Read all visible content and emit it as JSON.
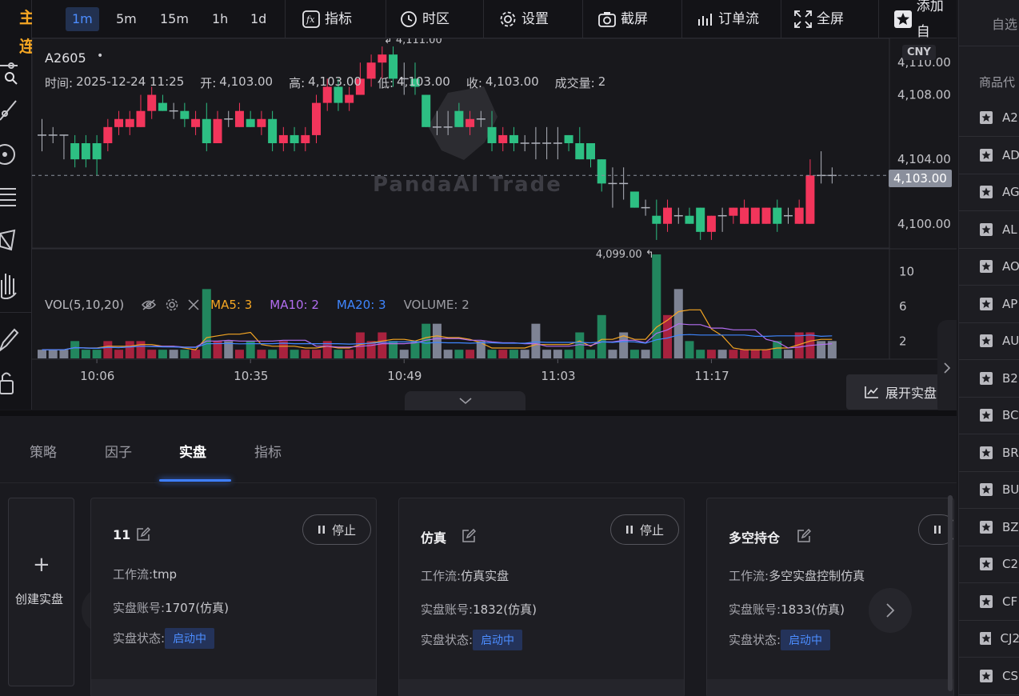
{
  "brand": {
    "line1": "主",
    "line2": "连"
  },
  "toolbar": {
    "timeframes": [
      "1m",
      "5m",
      "15m",
      "1h",
      "1d"
    ],
    "active_timeframe": "1m",
    "indicators_label": "指标",
    "timezone_label": "时区",
    "settings_label": "设置",
    "screenshot_label": "截屏",
    "orderflow_label": "订单流",
    "fullscreen_label": "全屏",
    "add_label": "添加自"
  },
  "chart": {
    "symbol": "A2605",
    "currency": "CNY",
    "time_label": "时间:",
    "time_value": "2025-12-24 11:25",
    "open_label": "开:",
    "open_value": "4,103.00",
    "high_label": "高:",
    "high_value": "4,103.00",
    "low_label": "低:",
    "low_value": "4,103.00",
    "close_label": "收:",
    "close_value": "4,103.00",
    "volume_label": "成交量:",
    "volume_value": "2",
    "watermark": "PandaAI Trade",
    "max_label": "4,111.00",
    "min_label": "4,099.00",
    "last_price": "4,103.00",
    "expand_label": "展开实盘"
  },
  "chart_data": {
    "type": "candlestick",
    "price_axis": {
      "ticks": [
        4100,
        4104,
        4108,
        4110
      ],
      "tick_labels": [
        "4,100.00",
        "4,104.00",
        "4,108.00",
        "4,110.00"
      ],
      "range": [
        4098.5,
        4111.5
      ]
    },
    "volume_axis": {
      "ticks": [
        2,
        6,
        10
      ],
      "tick_labels": [
        "2",
        "6",
        "10"
      ],
      "range": [
        0,
        12
      ]
    },
    "time_ticks": [
      "10:06",
      "10:35",
      "10:49",
      "11:03",
      "11:17"
    ],
    "volume_legend": {
      "title": "VOL(5,10,20)",
      "ma5": "MA5: 3",
      "ma10": "MA10: 2",
      "ma20": "MA20: 3",
      "volume": "VOLUME: 2"
    },
    "candles": [
      {
        "o": 4105.5,
        "h": 4106.5,
        "l": 4104.5,
        "c": 4105.5,
        "v": 1
      },
      {
        "o": 4105.5,
        "h": 4106.0,
        "l": 4105.0,
        "c": 4105.5,
        "v": 1
      },
      {
        "o": 4105.5,
        "h": 4105.5,
        "l": 4104.0,
        "c": 4105.5,
        "v": 1
      },
      {
        "o": 4105.0,
        "h": 4105.5,
        "l": 4103.5,
        "c": 4104.0,
        "v": 2
      },
      {
        "o": 4105.0,
        "h": 4105.5,
        "l": 4103.5,
        "c": 4104.0,
        "v": 1
      },
      {
        "o": 4105.0,
        "h": 4105.5,
        "l": 4103.0,
        "c": 4104.0,
        "v": 1
      },
      {
        "o": 4105.0,
        "h": 4106.5,
        "l": 4104.5,
        "c": 4106.0,
        "v": 2
      },
      {
        "o": 4106.0,
        "h": 4107.0,
        "l": 4105.5,
        "c": 4106.5,
        "v": 1
      },
      {
        "o": 4106.0,
        "h": 4107.0,
        "l": 4105.5,
        "c": 4106.5,
        "v": 2
      },
      {
        "o": 4106.0,
        "h": 4108.0,
        "l": 4106.0,
        "c": 4107.0,
        "v": 2
      },
      {
        "o": 4107.0,
        "h": 4108.5,
        "l": 4106.5,
        "c": 4108.0,
        "v": 1
      },
      {
        "o": 4107.5,
        "h": 4108.0,
        "l": 4107.0,
        "c": 4107.0,
        "v": 1
      },
      {
        "o": 4107.0,
        "h": 4107.5,
        "l": 4106.5,
        "c": 4107.0,
        "v": 1
      },
      {
        "o": 4107.0,
        "h": 4107.5,
        "l": 4106.0,
        "c": 4106.5,
        "v": 1
      },
      {
        "o": 4106.0,
        "h": 4107.0,
        "l": 4105.5,
        "c": 4106.5,
        "v": 1
      },
      {
        "o": 4106.5,
        "h": 4107.5,
        "l": 4104.5,
        "c": 4105.0,
        "v": 8
      },
      {
        "o": 4105.0,
        "h": 4107.0,
        "l": 4105.0,
        "c": 4106.5,
        "v": 2
      },
      {
        "o": 4106.5,
        "h": 4107.0,
        "l": 4106.0,
        "c": 4106.5,
        "v": 2
      },
      {
        "o": 4106.0,
        "h": 4107.5,
        "l": 4106.0,
        "c": 4107.0,
        "v": 1
      },
      {
        "o": 4106.5,
        "h": 4107.0,
        "l": 4106.0,
        "c": 4106.0,
        "v": 2
      },
      {
        "o": 4106.0,
        "h": 4107.0,
        "l": 4105.5,
        "c": 4106.5,
        "v": 1
      },
      {
        "o": 4106.5,
        "h": 4107.0,
        "l": 4104.5,
        "c": 4105.0,
        "v": 1
      },
      {
        "o": 4105.0,
        "h": 4106.0,
        "l": 4104.5,
        "c": 4105.5,
        "v": 2
      },
      {
        "o": 4105.5,
        "h": 4106.0,
        "l": 4104.5,
        "c": 4105.0,
        "v": 1
      },
      {
        "o": 4105.0,
        "h": 4106.0,
        "l": 4104.5,
        "c": 4105.5,
        "v": 1
      },
      {
        "o": 4105.5,
        "h": 4108.0,
        "l": 4105.0,
        "c": 4107.5,
        "v": 1
      },
      {
        "o": 4107.5,
        "h": 4109.0,
        "l": 4107.0,
        "c": 4108.5,
        "v": 2
      },
      {
        "o": 4108.5,
        "h": 4109.0,
        "l": 4107.0,
        "c": 4107.5,
        "v": 1
      },
      {
        "o": 4107.5,
        "h": 4108.5,
        "l": 4107.0,
        "c": 4108.0,
        "v": 1
      },
      {
        "o": 4108.0,
        "h": 4110.0,
        "l": 4108.0,
        "c": 4109.0,
        "v": 3
      },
      {
        "o": 4109.0,
        "h": 4110.5,
        "l": 4108.5,
        "c": 4110.0,
        "v": 2
      },
      {
        "o": 4110.0,
        "h": 4111.0,
        "l": 4109.0,
        "c": 4110.5,
        "v": 3
      },
      {
        "o": 4110.5,
        "h": 4111.0,
        "l": 4108.5,
        "c": 4109.0,
        "v": 2
      },
      {
        "o": 4109.0,
        "h": 4110.0,
        "l": 4108.0,
        "c": 4109.0,
        "v": 1
      },
      {
        "o": 4109.0,
        "h": 4110.0,
        "l": 4108.0,
        "c": 4108.5,
        "v": 2
      },
      {
        "o": 4108.0,
        "h": 4108.0,
        "l": 4106.0,
        "c": 4106.0,
        "v": 4
      },
      {
        "o": 4106.0,
        "h": 4107.0,
        "l": 4105.5,
        "c": 4106.0,
        "v": 4
      },
      {
        "o": 4106.0,
        "h": 4107.0,
        "l": 4105.5,
        "c": 4106.0,
        "v": 1
      },
      {
        "o": 4107.0,
        "h": 4107.5,
        "l": 4106.0,
        "c": 4106.0,
        "v": 1
      },
      {
        "o": 4106.0,
        "h": 4107.0,
        "l": 4105.5,
        "c": 4106.5,
        "v": 1
      },
      {
        "o": 4106.5,
        "h": 4107.0,
        "l": 4106.0,
        "c": 4106.5,
        "v": 2
      },
      {
        "o": 4106.0,
        "h": 4107.0,
        "l": 4104.5,
        "c": 4105.0,
        "v": 1
      },
      {
        "o": 4105.0,
        "h": 4106.0,
        "l": 4104.5,
        "c": 4105.5,
        "v": 1
      },
      {
        "o": 4105.5,
        "h": 4106.0,
        "l": 4104.5,
        "c": 4105.0,
        "v": 1
      },
      {
        "o": 4105.0,
        "h": 4105.5,
        "l": 4104.5,
        "c": 4105.0,
        "v": 1
      },
      {
        "o": 4105.0,
        "h": 4106.0,
        "l": 4104.0,
        "c": 4105.0,
        "v": 4
      },
      {
        "o": 4105.0,
        "h": 4106.0,
        "l": 4104.0,
        "c": 4105.0,
        "v": 1
      },
      {
        "o": 4105.0,
        "h": 4106.0,
        "l": 4104.0,
        "c": 4105.0,
        "v": 1
      },
      {
        "o": 4105.5,
        "h": 4105.5,
        "l": 4104.5,
        "c": 4105.0,
        "v": 1
      },
      {
        "o": 4105.0,
        "h": 4106.0,
        "l": 4104.0,
        "c": 4104.0,
        "v": 3
      },
      {
        "o": 4105.0,
        "h": 4105.0,
        "l": 4103.5,
        "c": 4104.0,
        "v": 1
      },
      {
        "o": 4104.0,
        "h": 4104.0,
        "l": 4102.0,
        "c": 4102.5,
        "v": 5
      },
      {
        "o": 4102.5,
        "h": 4103.5,
        "l": 4101.0,
        "c": 4102.5,
        "v": 1
      },
      {
        "o": 4102.5,
        "h": 4103.5,
        "l": 4101.5,
        "c": 4102.5,
        "v": 3
      },
      {
        "o": 4102.0,
        "h": 4102.0,
        "l": 4101.0,
        "c": 4101.0,
        "v": 1
      },
      {
        "o": 4101.0,
        "h": 4101.5,
        "l": 4100.5,
        "c": 4101.0,
        "v": 1
      },
      {
        "o": 4100.5,
        "h": 4101.5,
        "l": 4099.0,
        "c": 4100.0,
        "v": 12
      },
      {
        "o": 4100.0,
        "h": 4101.5,
        "l": 4099.5,
        "c": 4101.0,
        "v": 5
      },
      {
        "o": 4100.5,
        "h": 4101.0,
        "l": 4100.0,
        "c": 4100.5,
        "v": 8
      },
      {
        "o": 4100.5,
        "h": 4101.0,
        "l": 4100.0,
        "c": 4100.0,
        "v": 2
      },
      {
        "o": 4101.0,
        "h": 4101.0,
        "l": 4099.0,
        "c": 4099.5,
        "v": 1
      },
      {
        "o": 4099.5,
        "h": 4100.5,
        "l": 4099.0,
        "c": 4100.5,
        "v": 1
      },
      {
        "o": 4100.5,
        "h": 4101.0,
        "l": 4099.5,
        "c": 4100.5,
        "v": 1
      },
      {
        "o": 4100.5,
        "h": 4101.0,
        "l": 4100.0,
        "c": 4101.0,
        "v": 1
      },
      {
        "o": 4100.0,
        "h": 4101.5,
        "l": 4100.0,
        "c": 4101.0,
        "v": 1
      },
      {
        "o": 4100.0,
        "h": 4101.0,
        "l": 4100.0,
        "c": 4101.0,
        "v": 1
      },
      {
        "o": 4100.0,
        "h": 4101.0,
        "l": 4100.0,
        "c": 4101.0,
        "v": 1
      },
      {
        "o": 4101.0,
        "h": 4101.5,
        "l": 4099.5,
        "c": 4100.0,
        "v": 2
      },
      {
        "o": 4100.5,
        "h": 4101.0,
        "l": 4100.0,
        "c": 4100.5,
        "v": 1
      },
      {
        "o": 4100.0,
        "h": 4101.5,
        "l": 4100.0,
        "c": 4101.0,
        "v": 3
      },
      {
        "o": 4100.0,
        "h": 4104.0,
        "l": 4100.0,
        "c": 4103.0,
        "v": 3
      },
      {
        "o": 4103.0,
        "h": 4104.5,
        "l": 4102.5,
        "c": 4103.0,
        "v": 2
      },
      {
        "o": 4103.0,
        "h": 4103.5,
        "l": 4102.5,
        "c": 4103.0,
        "v": 2
      }
    ]
  },
  "bottom": {
    "tabs": [
      "策略",
      "因子",
      "实盘",
      "指标"
    ],
    "active_tab": "实盘",
    "create_label": "创建实盘",
    "workflow_label": "工作流:",
    "account_label": "实盘账号:",
    "status_label": "实盘状态:",
    "stop_label": "停止",
    "cards": [
      {
        "title": "11",
        "workflow": "tmp",
        "account": "1707(仿真)",
        "status": "启动中"
      },
      {
        "title": "仿真",
        "workflow": "仿真实盘",
        "account": "1832(仿真)",
        "status": "启动中"
      },
      {
        "title": "多空持仓",
        "workflow": "多空实盘控制仿真",
        "account": "1833(仿真)",
        "status": "启动中"
      }
    ]
  },
  "right_panel": {
    "tab_label": "自选",
    "header": "商品代",
    "items": [
      "A2",
      "AD",
      "AG",
      "AL",
      "AO",
      "AP",
      "AU",
      "B2",
      "BC",
      "BR",
      "BU",
      "BZ",
      "C2",
      "CF",
      "CJ2",
      "CS"
    ]
  },
  "colors": {
    "up": "#f2355b",
    "down": "#2dbf83",
    "neutral": "#8a8f9c",
    "accent": "#4c8dff",
    "brand": "#f5a623"
  }
}
